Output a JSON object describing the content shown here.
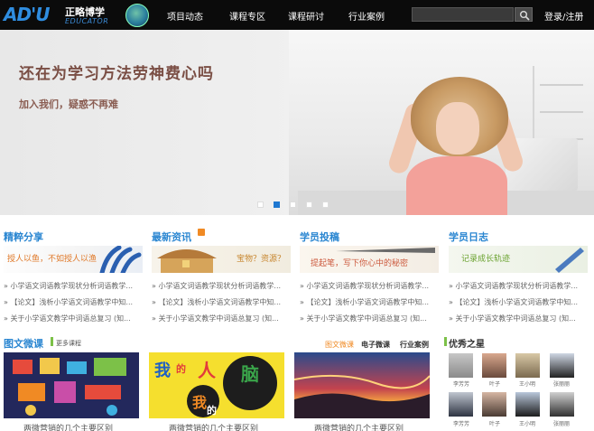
{
  "header": {
    "logo_mark": "AD'U",
    "logo_name": "正略博学",
    "logo_sub": "EDUCATOR",
    "nav": [
      "项目动态",
      "课程专区",
      "课程研讨",
      "行业案例"
    ],
    "search_placeholder": "",
    "search_icon": "search-icon",
    "login": "登录/注册"
  },
  "banner": {
    "headline": "还在为学习方法劳神费心吗",
    "tagline": "加入我们，疑惑不再难",
    "slides": 6,
    "active_slide": 2
  },
  "columns": [
    {
      "title": "精粹分享",
      "image_caption": "授人以鱼，不如授人以渔",
      "items": [
        "小学语文词语教学现状分析词语教学...",
        "【论文】浅析小学语文词语教学中知...",
        "关于小学语文教学中词语总复习 (知..."
      ]
    },
    {
      "title": "最新资讯",
      "image_caption": "宝物？资源？",
      "items": [
        "小学语文词语教学现状分析词语教学...",
        "【论文】浅析小学语文词语教学中知...",
        "关于小学语文教学中词语总复习 (知..."
      ]
    },
    {
      "title": "学员投稿",
      "image_caption": "提起笔，写下你心中的秘密",
      "items": [
        "小学语文词语教学现状分析词语教学...",
        "【论文】浅析小学语文词语教学中知...",
        "关于小学语文教学中词语总复习 (知..."
      ]
    },
    {
      "title": "学员日志",
      "image_caption": "记录成长轨迹",
      "items": [
        "小学语文词语教学现状分析词语教学...",
        "【论文】浅析小学语文词语教学中知...",
        "关于小学语文教学中词语总复习 (知..."
      ]
    }
  ],
  "micro": {
    "title": "图文微课",
    "more": "更多课程",
    "tabs": [
      "图文微课",
      "电子微课",
      "行业案例"
    ],
    "thumbs": [
      {
        "caption": "两微营销的几个主要区别"
      },
      {
        "caption": "两微营销的几个主要区别"
      },
      {
        "caption": "两微营销的几个主要区别"
      }
    ],
    "thumb2_text": [
      "我",
      "的",
      "人",
      "脑",
      "我",
      "的"
    ]
  },
  "stars": {
    "title": "优秀之星",
    "people": [
      {
        "name": "李芳芳"
      },
      {
        "name": "叶子"
      },
      {
        "name": "王小明"
      },
      {
        "name": "张丽丽"
      },
      {
        "name": "李芳芳"
      },
      {
        "name": "叶子"
      },
      {
        "name": "王小明"
      },
      {
        "name": "张丽丽"
      }
    ]
  },
  "colors": {
    "header_bg": "#0b0b0b",
    "accent_blue": "#2a86d1",
    "accent_orange": "#f08a24",
    "accent_green": "#7cc148"
  }
}
